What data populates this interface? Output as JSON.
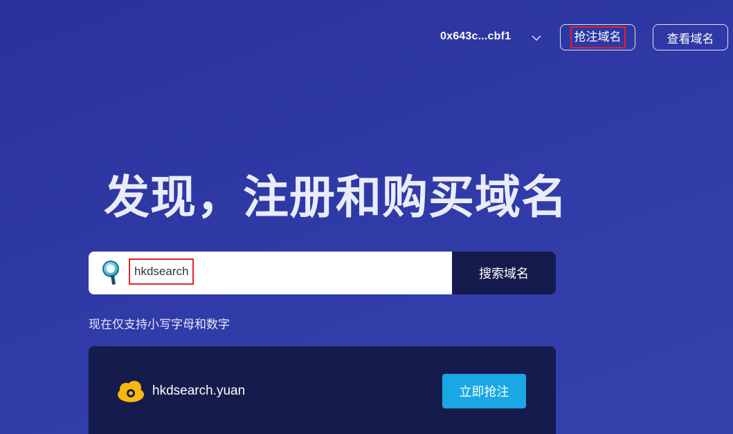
{
  "header": {
    "wallet_address": "0x643c...cbf1",
    "register_label": "抢注域名",
    "view_label": "查看域名"
  },
  "hero": {
    "headline": "发现，注册和购买域名"
  },
  "search": {
    "value": "hkdsearch",
    "button_label": "搜索域名",
    "hint": "现在仅支持小写字母和数字"
  },
  "result": {
    "domain": "hkdsearch.yuan",
    "button_label": "立即抢注"
  },
  "colors": {
    "background": "#2f3aa6",
    "dark_panel": "#161b4d",
    "accent": "#1aa7e4",
    "highlight_border": "#e0222b"
  }
}
